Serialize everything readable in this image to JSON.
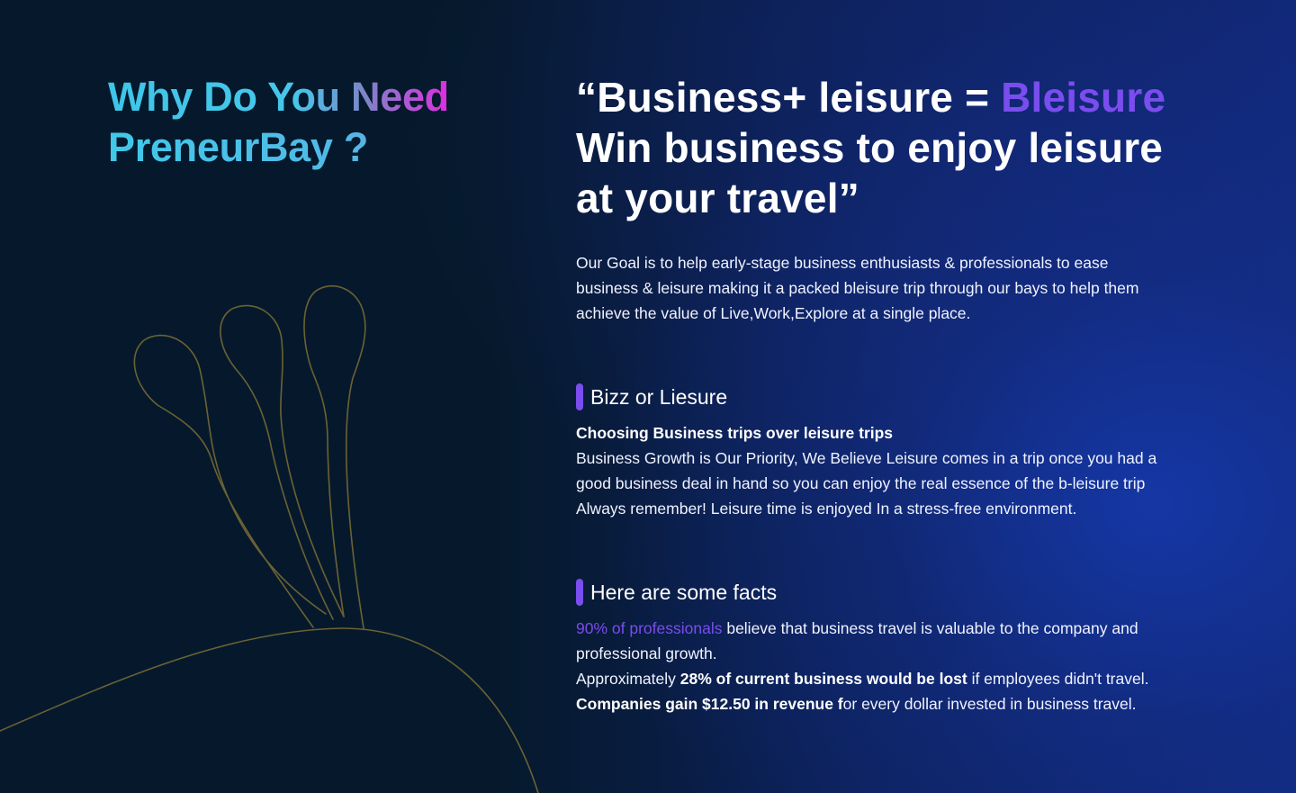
{
  "left": {
    "heading_part1": "Why Do You Need",
    "heading_part2": "PreneurBay ?"
  },
  "quote": {
    "line1_prefix": "“Business+ leisure = ",
    "line1_highlight": "Bleisure",
    "line2": "Win business to enjoy leisure",
    "line3": "at your travel”"
  },
  "goal": {
    "line1": "Our Goal is to help early-stage business enthusiasts & professionals to ease",
    "line2": "business & leisure  making it a packed bleisure trip  through our bays to help them",
    "line3": "achieve the value of Live,Work,Explore at a single place."
  },
  "section1": {
    "title": "Bizz or Liesure",
    "subtitle": "Choosing Business trips over leisure trips",
    "line1": "Business Growth is Our Priority, We Believe Leisure comes in a trip once you had a",
    "line2": "good business deal in hand so you can enjoy the real essence of the b-leisure trip",
    "line3": "Always remember! Leisure time is enjoyed In a stress-free environment."
  },
  "section2": {
    "title": "Here are some facts",
    "fact1_highlight": "90% of professionals",
    "fact1_rest": " believe that business travel is valuable to the company and",
    "fact1_line2": "professional growth.",
    "fact2_prefix": "Approximately ",
    "fact2_bold": "28% of current business would be lost",
    "fact2_rest": " if employees didn't travel.",
    "fact3_bold": "Companies gain $12.50 in revenue f",
    "fact3_rest": "or every dollar invested in business travel."
  },
  "colors": {
    "accent_purple": "#7a4dee",
    "heading_cyan": "#41c8e9",
    "heading_magenta": "#e02ce0",
    "decoration_line": "#6b6233",
    "background": "#07192e"
  },
  "decoration": {
    "icon": "abstract-petal-line-art"
  }
}
